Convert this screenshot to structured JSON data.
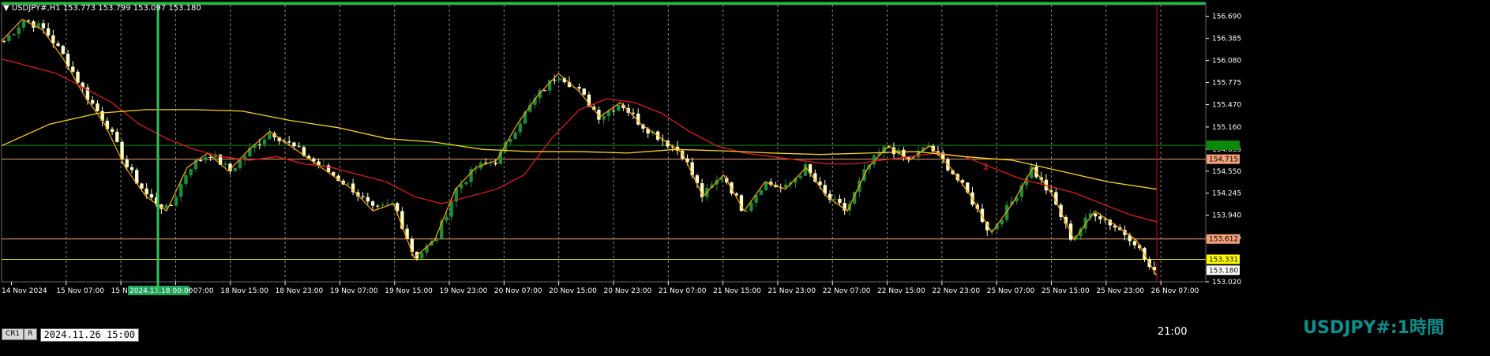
{
  "header": {
    "symbol_info": "USDJPY#,H1  153.773 153.799 153.097 153.180"
  },
  "watermark": {
    "text": "USDJPY#:1時間"
  },
  "controls": {
    "cr1_label": "CR1",
    "r_label": "R",
    "datetime": "2024.11.26  15:00"
  },
  "timer": {
    "label": "21:00"
  },
  "price_axis": {
    "ticks": [
      "156.690",
      "156.385",
      "156.080",
      "155.775",
      "155.470",
      "155.160",
      "154.855",
      "154.550",
      "154.245",
      "153.940",
      "153.635",
      "153.020"
    ],
    "tags": [
      {
        "text": "154.907",
        "bg": "#0a8a0a",
        "fg": "#0a8a0a"
      },
      {
        "text": "154.715",
        "bg": "#f4a07a",
        "fg": "#000000"
      },
      {
        "text": "153.612",
        "bg": "#f4a07a",
        "fg": "#000000"
      },
      {
        "text": "153.331",
        "bg": "#ffff00",
        "fg": "#000000"
      },
      {
        "text": "153.180",
        "bg": "#ffffff",
        "fg": "#000000"
      }
    ]
  },
  "time_axis": {
    "labels": [
      "14 Nov 2024",
      "15 Nov 07:00",
      "15 Nov",
      "18 Nov 07:00",
      "18 Nov 15:00",
      "18 Nov 23:00",
      "19 Nov 07:00",
      "19 Nov 15:00",
      "19 Nov 23:00",
      "20 Nov 07:00",
      "20 Nov 15:00",
      "20 Nov 23:00",
      "21 Nov 07:00",
      "21 Nov 15:00",
      "21 Nov 23:00",
      "22 Nov 07:00",
      "22 Nov 15:00",
      "22 Nov 23:00",
      "25 Nov 07:00",
      "25 Nov 15:00",
      "25 Nov 23:00",
      "26 Nov 07:00"
    ],
    "highlight_label": "2024.11.18 00:00"
  },
  "colors": {
    "background": "#000000",
    "grid": "#8a8a8a",
    "bull": "#1a8f3a",
    "bear": "#ffffcc",
    "ma_fast": "#dd1a1a",
    "ma_slow": "#ffd21a",
    "zigzag": "#ffa500",
    "orange_line": "#f4a07a",
    "yellow_line": "#ffff00",
    "green_line": "#0a8a0a",
    "marker": "#ff3030",
    "cursor": "#cc0000"
  },
  "chart_data": {
    "type": "candlestick",
    "symbol": "USDJPY#",
    "timeframe": "H1",
    "ylim": [
      153.02,
      156.85
    ],
    "x_categories": [
      "14 Nov 2024",
      "15 Nov 07:00",
      "15 Nov",
      "18 Nov 07:00",
      "18 Nov 15:00",
      "18 Nov 23:00",
      "19 Nov 07:00",
      "19 Nov 15:00",
      "19 Nov 23:00",
      "20 Nov 07:00",
      "20 Nov 15:00",
      "20 Nov 23:00",
      "21 Nov 07:00",
      "21 Nov 15:00",
      "21 Nov 23:00",
      "22 Nov 07:00",
      "22 Nov 15:00",
      "22 Nov 23:00",
      "25 Nov 07:00",
      "25 Nov 15:00",
      "25 Nov 23:00",
      "26 Nov 07:00"
    ],
    "close_path": [
      156.35,
      156.65,
      156.5,
      156.1,
      155.6,
      155.2,
      154.6,
      154.2,
      154.0,
      154.6,
      154.8,
      154.55,
      154.85,
      155.1,
      154.9,
      154.7,
      154.5,
      154.3,
      154.0,
      154.1,
      153.35,
      153.6,
      154.3,
      154.6,
      154.7,
      155.2,
      155.6,
      155.9,
      155.65,
      155.3,
      155.5,
      155.2,
      155.0,
      154.8,
      154.2,
      154.5,
      154.0,
      154.4,
      154.3,
      154.6,
      154.2,
      154.0,
      154.6,
      154.9,
      154.7,
      154.9,
      154.6,
      154.2,
      153.7,
      154.1,
      154.6,
      154.2,
      153.6,
      154.0,
      153.8,
      153.6,
      153.1
    ],
    "ma_fast": [
      156.1,
      156.0,
      155.9,
      155.7,
      155.5,
      155.2,
      155.0,
      154.85,
      154.75,
      154.7,
      154.75,
      154.65,
      154.6,
      154.5,
      154.4,
      154.2,
      154.1,
      154.2,
      154.3,
      154.5,
      155.0,
      155.4,
      155.55,
      155.5,
      155.35,
      155.1,
      154.9,
      154.8,
      154.75,
      154.7,
      154.65,
      154.65,
      154.7,
      154.75,
      154.8,
      154.75,
      154.6,
      154.45,
      154.35,
      154.25,
      154.1,
      153.95,
      153.85
    ],
    "ma_slow": [
      154.9,
      155.2,
      155.35,
      155.4,
      155.4,
      155.38,
      155.25,
      155.15,
      155.0,
      154.95,
      154.85,
      154.82,
      154.82,
      154.8,
      154.85,
      154.83,
      154.8,
      154.78,
      154.8,
      154.82,
      154.75,
      154.7,
      154.55,
      154.4,
      154.3
    ],
    "horizontal_levels": [
      {
        "value": 154.907,
        "label": "154.907"
      },
      {
        "value": 154.715,
        "label": "154.715"
      },
      {
        "value": 153.612,
        "label": "153.612"
      },
      {
        "value": 153.331,
        "label": "153.331"
      },
      {
        "value": 153.18,
        "label": "153.180"
      }
    ],
    "current_price": 153.18
  }
}
